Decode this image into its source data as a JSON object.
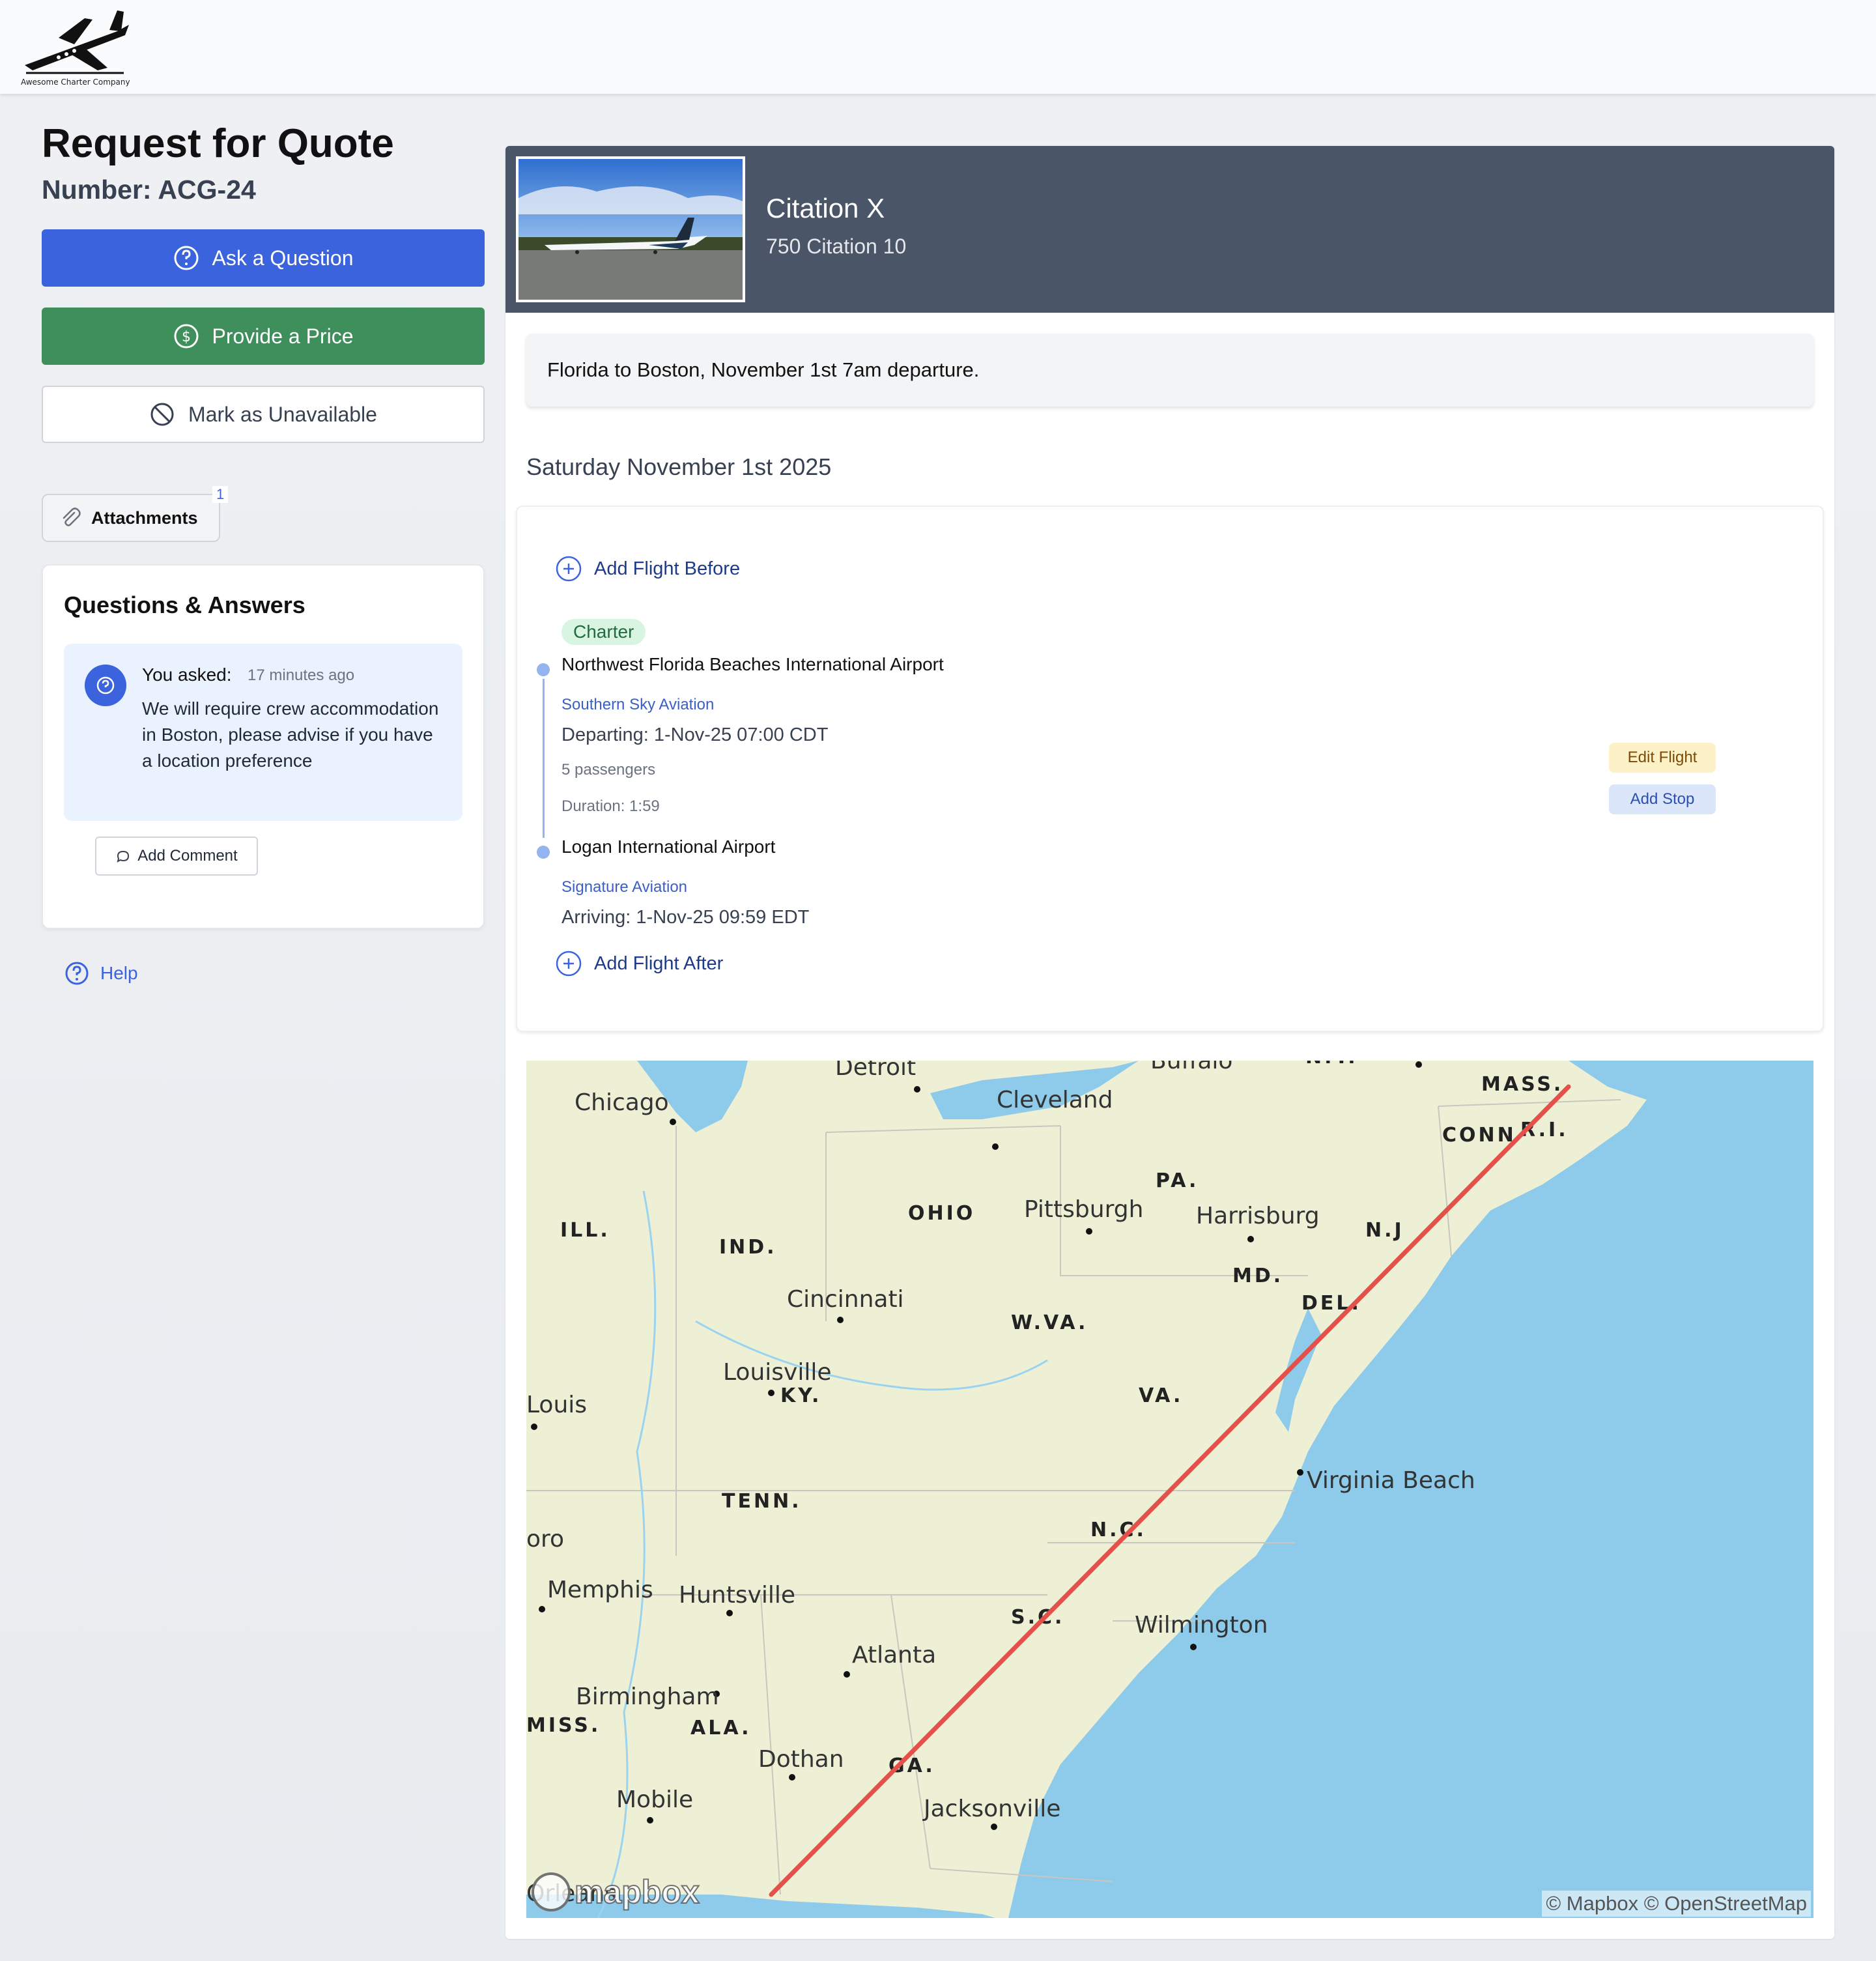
{
  "brand": {
    "logo_text": "Awesome Charter Company"
  },
  "page": {
    "title": "Request for Quote",
    "number": "Number: ACG-24"
  },
  "actions": {
    "ask_label": "Ask a Question",
    "price_label": "Provide a Price",
    "unavailable_label": "Mark as Unavailable"
  },
  "attachments": {
    "label": "Attachments",
    "count": "1"
  },
  "qa": {
    "title": "Questions & Answers",
    "items": [
      {
        "who": "You asked:",
        "time": "17 minutes ago",
        "text": "We will require crew accommodation in Boston, please advise if you have a location preference"
      }
    ],
    "add_comment_label": "Add Comment"
  },
  "help_label": "Help",
  "aircraft": {
    "name": "Citation X",
    "model": "750 Citation 10"
  },
  "request_note": "Florida to Boston, November 1st 7am departure.",
  "trip": {
    "date": "Saturday November 1st 2025",
    "add_before_label": "Add Flight Before",
    "add_after_label": "Add Flight After",
    "leg": {
      "type": "Charter",
      "from_airport": "Northwest Florida Beaches International Airport",
      "from_fbo": "Southern Sky Aviation",
      "departing": "Departing: 1-Nov-25 07:00 CDT",
      "passengers": "5 passengers",
      "duration": "Duration: 1:59",
      "to_airport": "Logan International Airport",
      "to_fbo": "Signature Aviation",
      "arriving": "Arriving: 1-Nov-25 09:59 EDT",
      "edit_label": "Edit Flight",
      "add_stop_label": "Add Stop"
    }
  },
  "map": {
    "attribution": "© Mapbox © OpenStreetMap",
    "logo": "mapbox",
    "route_color": "#e4514a",
    "cities": [
      "Detroit",
      "Buffalo",
      "Chicago",
      "Cleveland",
      "Pittsburgh",
      "Harrisburg",
      "Cincinnati",
      "Louisville",
      "Louis",
      "Virginia Beach",
      "oro",
      "Memphis",
      "Huntsville",
      "Wilmington",
      "Atlanta",
      "Birmingham",
      "Dothan",
      "Mobile",
      "Jacksonville",
      "Orleans"
    ],
    "states": [
      "N.Y.",
      "MASS.",
      "CONN",
      "R.I.",
      "PA.",
      "OHIO",
      "ILL.",
      "IND.",
      "N.J",
      "MD.",
      "DEL.",
      "W.VA.",
      "VA.",
      "KY.",
      "TENN.",
      "N.C.",
      "S.C.",
      "MISS.",
      "ALA.",
      "GA."
    ]
  },
  "colors": {
    "primary": "#3b63de",
    "success": "#3f8f5c",
    "hero_bg": "#4a5568",
    "water": "#8ecbea",
    "land": "#eef0d6"
  }
}
